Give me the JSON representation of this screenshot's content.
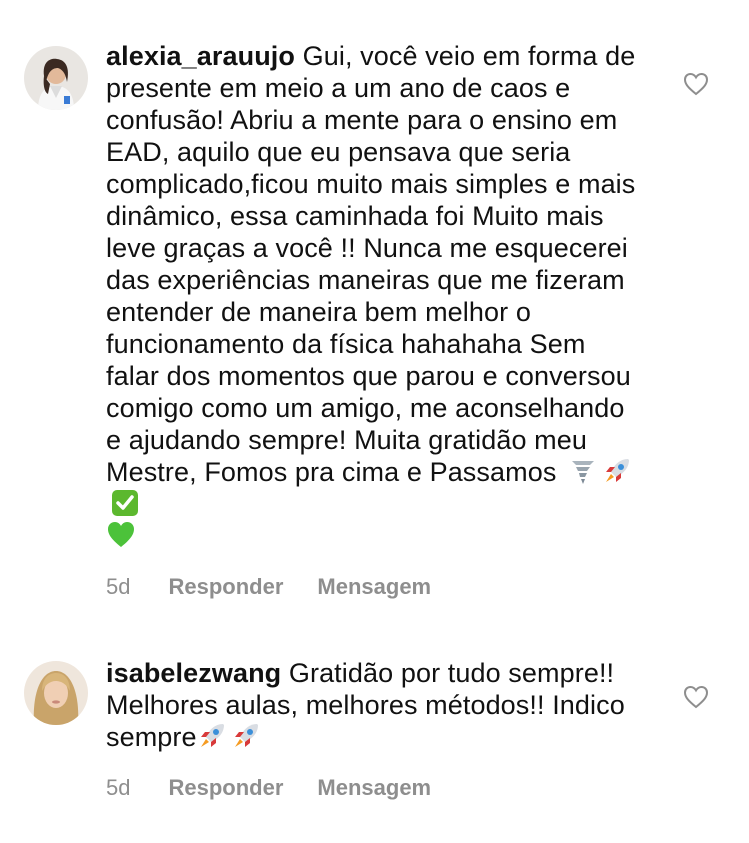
{
  "comments": [
    {
      "username": "alexia_arauujo",
      "text": "Gui, você veio em forma de presente em meio a um ano de caos e confusão! Abriu a mente para o ensino em EAD, aquilo que eu pensava que seria complicado,ficou muito mais simples e mais dinâmico, essa caminhada foi Muito mais leve graças a você !! Nunca me esquecerei das experiências maneiras que me fizeram entender de maneira bem melhor o funcionamento da física hahahaha Sem falar dos momentos que parou e conversou comigo como um amigo, me aconselhando e ajudando sempre! Muita gratidão meu Mestre, Fomos pra cima e Passamos",
      "emojis": [
        "tornado",
        "rocket",
        "check-mark-button",
        "green-heart"
      ],
      "time": "5d",
      "reply_label": "Responder",
      "message_label": "Mensagem"
    },
    {
      "username": "isabelezwang",
      "text": "Gratidão por tudo sempre!! Melhores aulas, melhores métodos!! Indico sempre",
      "emojis": [
        "rocket",
        "rocket"
      ],
      "time": "5d",
      "reply_label": "Responder",
      "message_label": "Mensagem"
    }
  ],
  "colors": {
    "text": "#111111",
    "meta": "#8e8e8e",
    "heart_stroke": "#8e8e8e",
    "check_green": "#5cb82e",
    "heart_green": "#4cc23a"
  }
}
